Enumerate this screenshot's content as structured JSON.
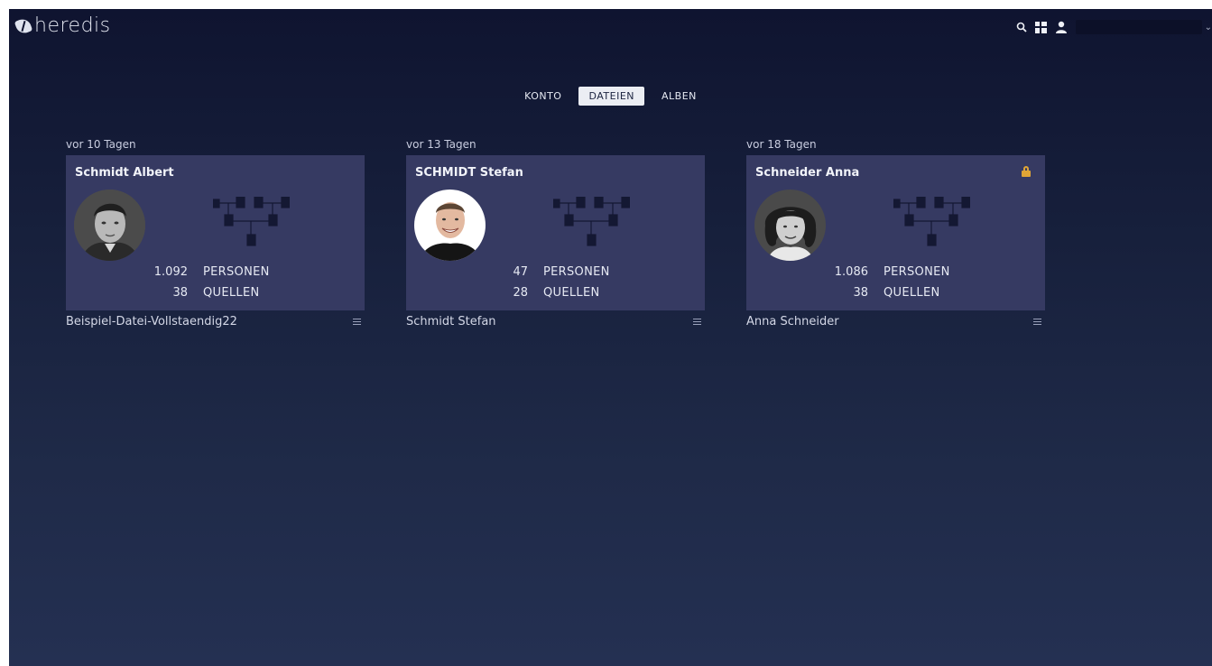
{
  "app": {
    "logo_text": "heredis"
  },
  "tabs": [
    {
      "label": "KONTO",
      "active": false
    },
    {
      "label": "DATEIEN",
      "active": true
    },
    {
      "label": "ALBEN",
      "active": false
    }
  ],
  "files": [
    {
      "date": "vor 10 Tagen",
      "title": "Schmidt Albert",
      "persons": "1.092",
      "persons_label": "PERSONEN",
      "sources": "38",
      "sources_label": "QUELLEN",
      "filename": "Beispiel-Datei-Vollstaendig22",
      "locked": false
    },
    {
      "date": "vor 13 Tagen",
      "title": "SCHMIDT Stefan",
      "persons": "47",
      "persons_label": "PERSONEN",
      "sources": "28",
      "sources_label": "QUELLEN",
      "filename": "Schmidt Stefan",
      "locked": false
    },
    {
      "date": "vor 18 Tagen",
      "title": "Schneider Anna",
      "persons": "1.086",
      "persons_label": "PERSONEN",
      "sources": "38",
      "sources_label": "QUELLEN",
      "filename": "Anna Schneider",
      "locked": true
    }
  ],
  "colors": {
    "background_top": "#0f1430",
    "background_bottom": "#243052",
    "card": "#363a62",
    "lock": "#e0a536"
  }
}
